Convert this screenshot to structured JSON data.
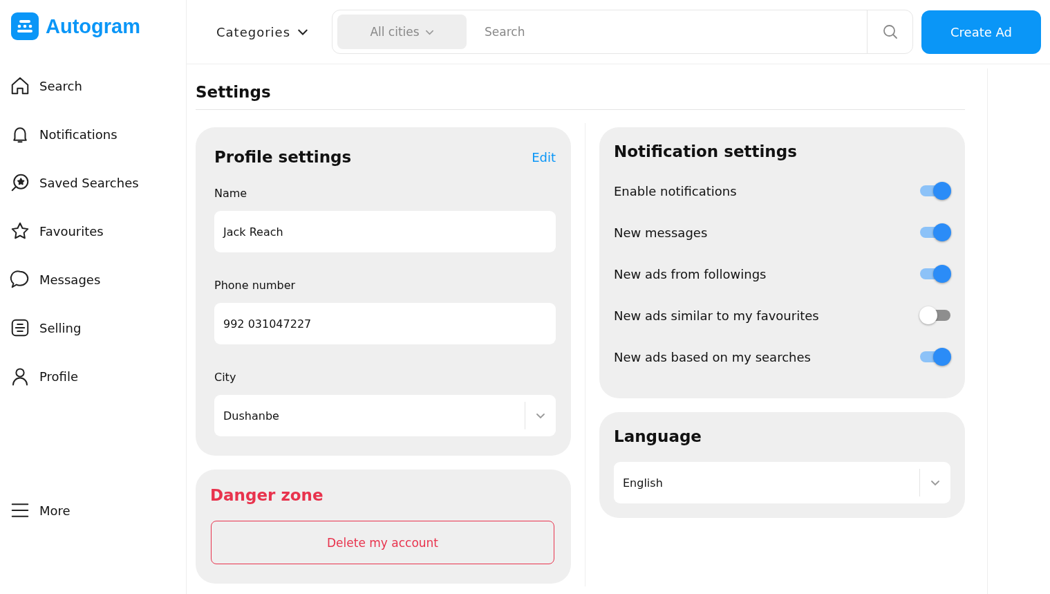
{
  "brand": {
    "name": "Autogram"
  },
  "sidebar": {
    "items": [
      {
        "label": "Search"
      },
      {
        "label": "Notifications"
      },
      {
        "label": "Saved Searches"
      },
      {
        "label": "Favourites"
      },
      {
        "label": "Messages"
      },
      {
        "label": "Selling"
      },
      {
        "label": "Profile"
      }
    ],
    "more": "More"
  },
  "header": {
    "categories": "Categories",
    "city": "All cities",
    "search_placeholder": "Search",
    "create_button": "Create Ad"
  },
  "page_title": "Settings",
  "profile": {
    "title": "Profile settings",
    "edit": "Edit",
    "fields": [
      {
        "label": "Name",
        "value": "Jack Reach",
        "kind": "text"
      },
      {
        "label": "Phone number",
        "value": "992 031047227",
        "kind": "text"
      },
      {
        "label": "City",
        "value": "Dushanbe",
        "kind": "select"
      }
    ]
  },
  "danger": {
    "title": "Danger zone",
    "button": "Delete my account"
  },
  "notifications": {
    "title": "Notification settings",
    "items": [
      {
        "label": "Enable notifications",
        "on": true
      },
      {
        "label": "New messages",
        "on": true
      },
      {
        "label": "New ads from followings",
        "on": true
      },
      {
        "label": "New ads similar to my favourites",
        "on": false
      },
      {
        "label": "New ads based on my searches",
        "on": true
      }
    ]
  },
  "language": {
    "title": "Language",
    "value": "English"
  }
}
